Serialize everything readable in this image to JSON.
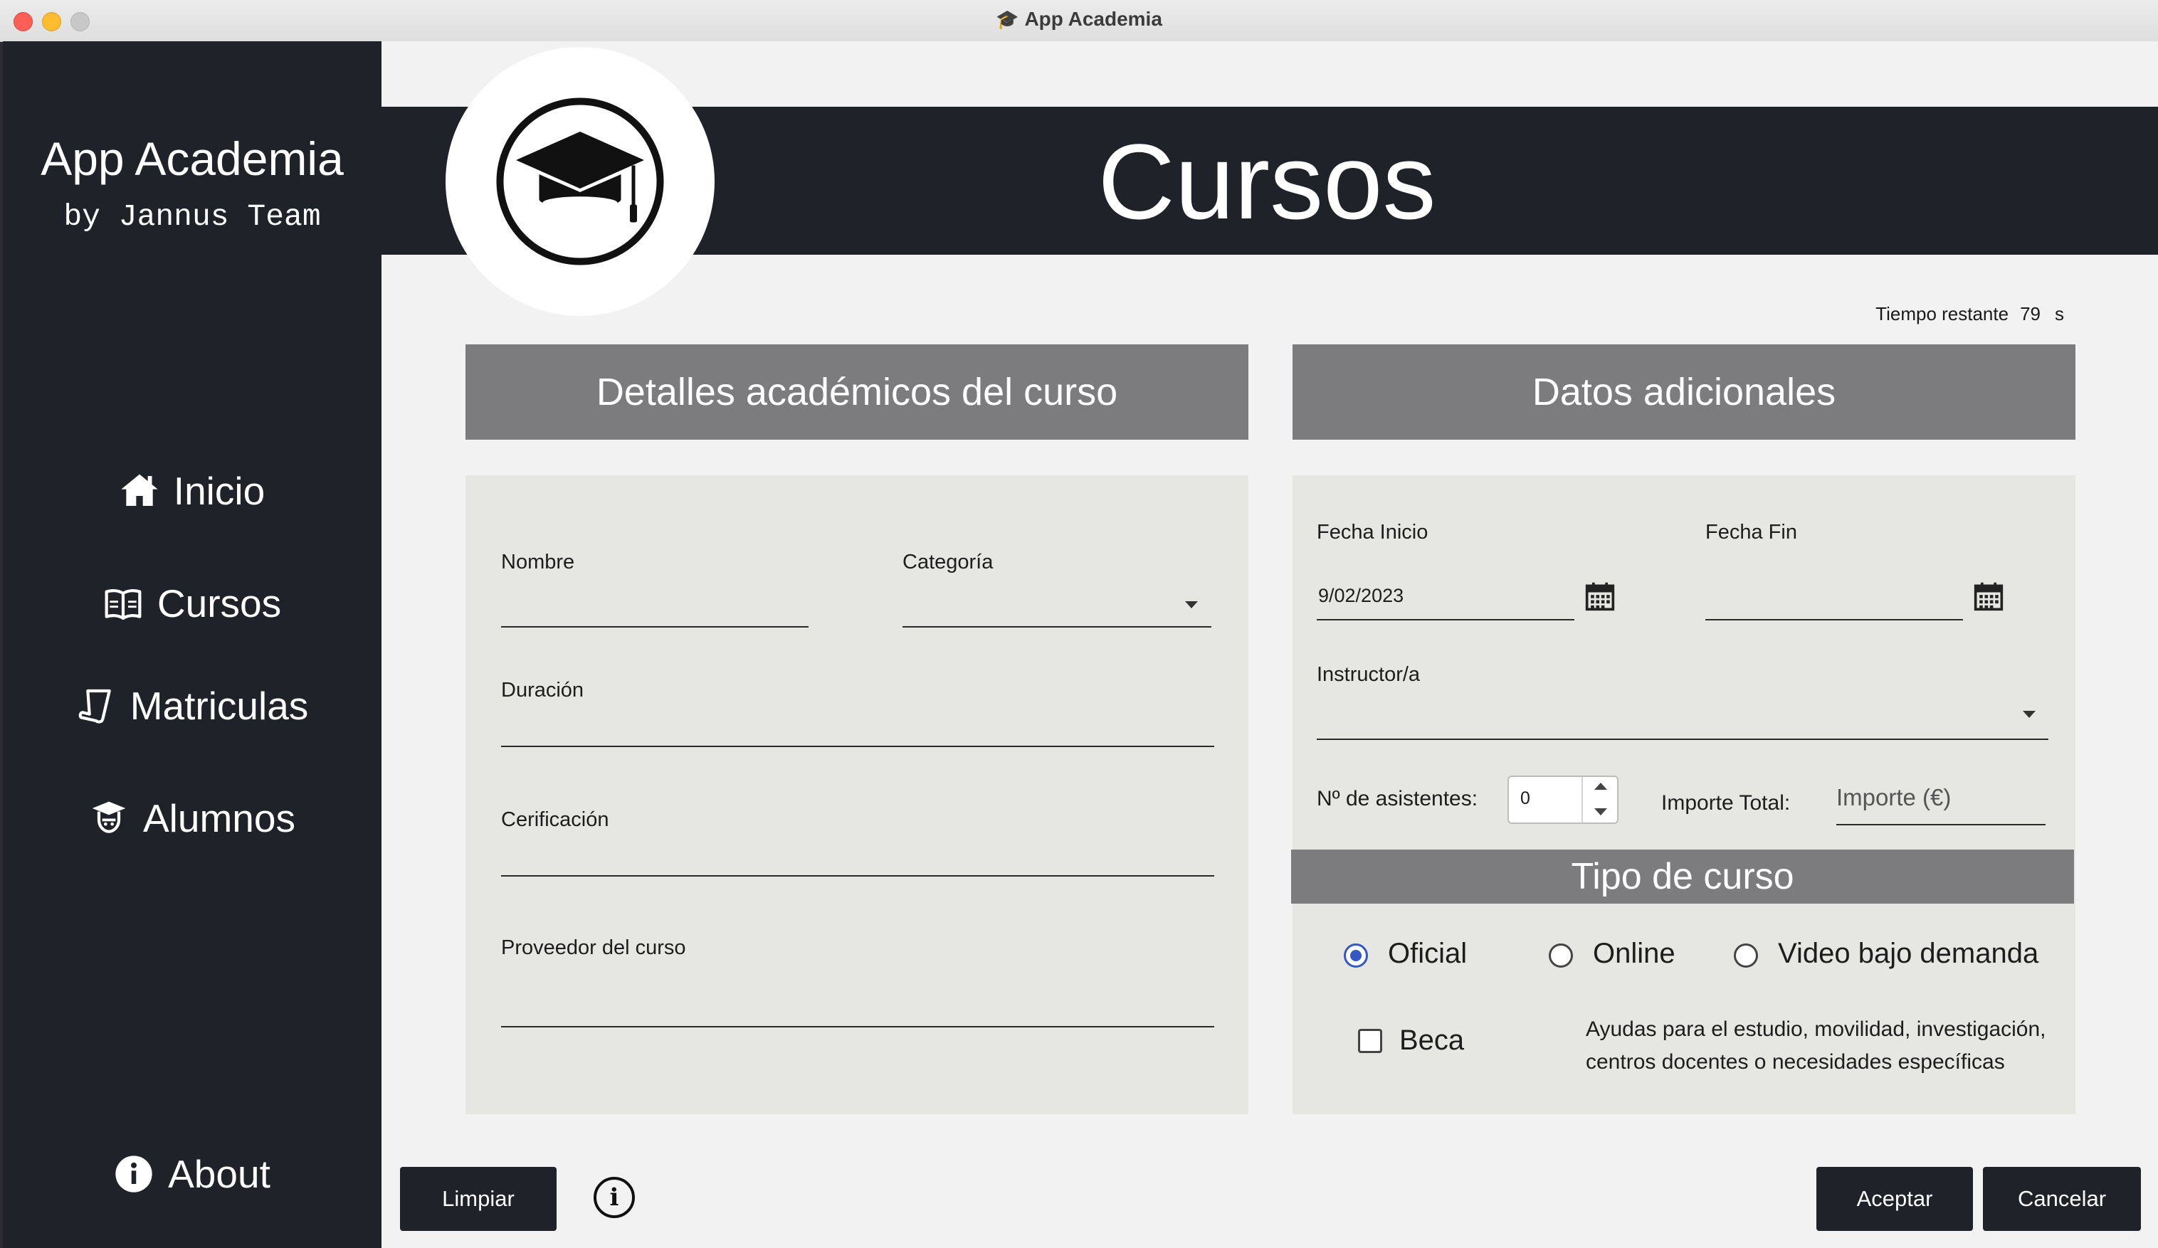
{
  "window": {
    "title": "App Academia",
    "title_icon": "graduation-cap-icon"
  },
  "sidebar": {
    "app_name": "App Academia",
    "app_byline": "by Jannus Team",
    "items": [
      {
        "label": "Inicio",
        "icon": "home-icon"
      },
      {
        "label": "Cursos",
        "icon": "open-book-icon"
      },
      {
        "label": "Matriculas",
        "icon": "scroll-icon"
      },
      {
        "label": "Alumnos",
        "icon": "student-icon"
      }
    ],
    "about": {
      "label": "About",
      "icon": "info-icon"
    }
  },
  "header": {
    "title": "Cursos",
    "logo_icon": "graduation-cap-icon"
  },
  "timer": {
    "label": "Tiempo restante",
    "value": "79",
    "unit": "s"
  },
  "left_panel": {
    "title": "Detalles académicos del curso",
    "nombre_label": "Nombre",
    "nombre_value": "",
    "categoria_label": "Categoría",
    "categoria_value": "",
    "duracion_label": "Duración",
    "duracion_value": "",
    "certificacion_label": "Cerificación",
    "certificacion_value": "",
    "proveedor_label": "Proveedor del curso",
    "proveedor_value": ""
  },
  "right_panel": {
    "title": "Datos adicionales",
    "fecha_inicio_label": "Fecha Inicio",
    "fecha_inicio_value": "9/02/2023",
    "fecha_fin_label": "Fecha Fin",
    "fecha_fin_value": "",
    "instructor_label": "Instructor/a",
    "instructor_value": "",
    "asistentes_label": "Nº de asistentes:",
    "asistentes_value": "0",
    "importe_label": "Importe Total:",
    "importe_placeholder": "Importe (€)"
  },
  "tipo_curso": {
    "title": "Tipo de curso",
    "options": [
      {
        "label": "Oficial",
        "checked": true
      },
      {
        "label": "Online",
        "checked": false
      },
      {
        "label": "Video bajo demanda",
        "checked": false
      }
    ],
    "beca_label": "Beca",
    "beca_checked": false,
    "beca_description": "Ayudas para el estudio, movilidad, investigación, centros docentes o necesidades específicas"
  },
  "buttons": {
    "limpiar": "Limpiar",
    "aceptar": "Aceptar",
    "cancelar": "Cancelar",
    "info": "i"
  },
  "colors": {
    "sidebar": "#202229",
    "panel_header": "#7c7c7f",
    "panel_bg": "#e6e6e3",
    "radio_accent": "#3457c6"
  }
}
